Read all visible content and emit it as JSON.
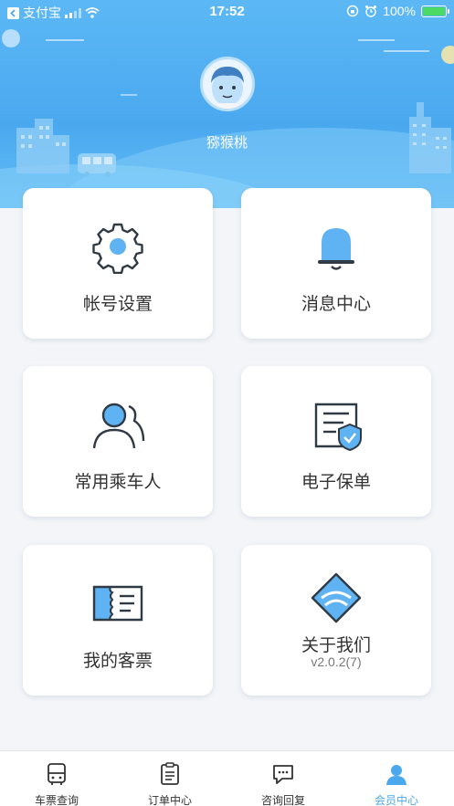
{
  "status_bar": {
    "carrier": "支付宝",
    "time": "17:52",
    "battery": "100%"
  },
  "profile": {
    "username": "猕猴桃"
  },
  "menu": [
    {
      "label": "帐号设置",
      "icon": "gear-icon"
    },
    {
      "label": "消息中心",
      "icon": "bell-icon"
    },
    {
      "label": "常用乘车人",
      "icon": "passengers-icon"
    },
    {
      "label": "电子保单",
      "icon": "insurance-policy-icon"
    },
    {
      "label": "我的客票",
      "icon": "ticket-icon"
    },
    {
      "label": "关于我们",
      "sub": "v2.0.2(7)",
      "icon": "about-logo-icon"
    }
  ],
  "tabs": [
    {
      "label": "车票查询",
      "icon": "bus-icon"
    },
    {
      "label": "订单中心",
      "icon": "order-list-icon"
    },
    {
      "label": "咨询回复",
      "icon": "chat-icon"
    },
    {
      "label": "会员中心",
      "icon": "member-icon",
      "active": true
    }
  ],
  "colors": {
    "primary": "#4aa8ef",
    "header_top": "#5cb8f5",
    "icon_dark": "#2f3a45",
    "icon_fill": "#5fb3f2"
  }
}
